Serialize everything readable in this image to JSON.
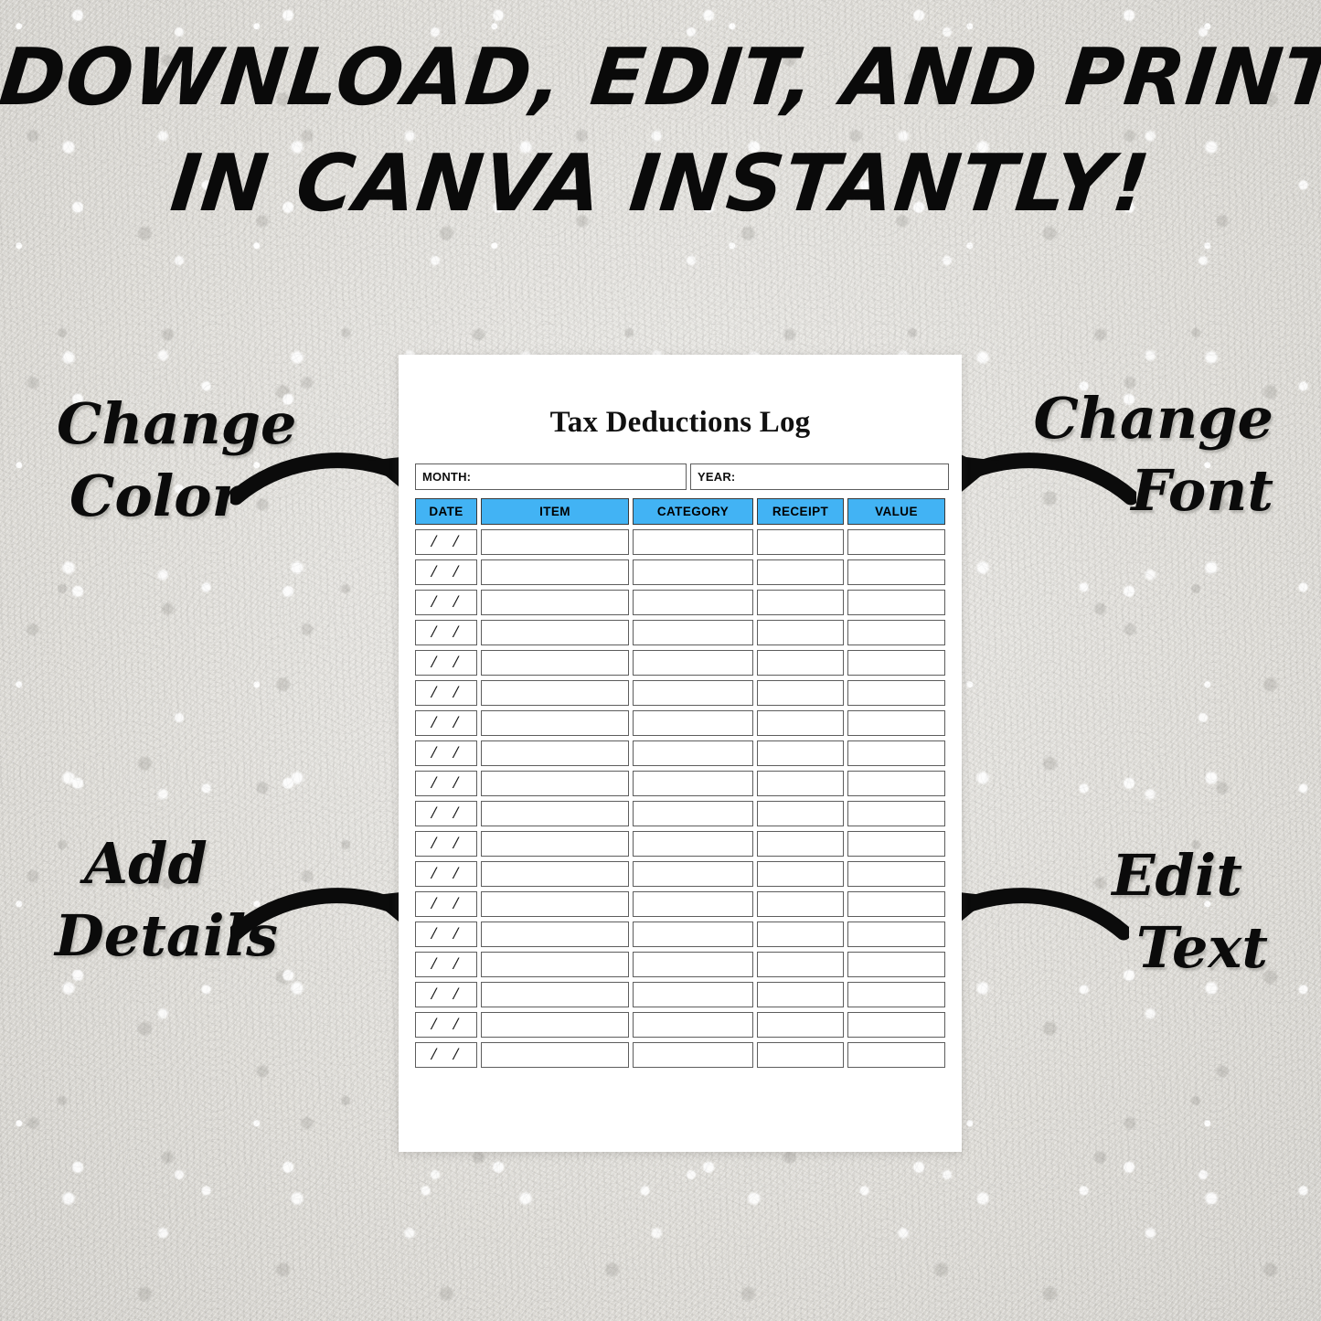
{
  "headline": {
    "line1": "DOWNLOAD, EDIT, AND PRINT",
    "line2": "IN CANVA INSTANTLY!"
  },
  "annotations": [
    {
      "id": "change-color",
      "line1": "Change",
      "line2": "Color",
      "arrow": "curved-arrow-right-icon"
    },
    {
      "id": "change-font",
      "line1": "Change",
      "line2": "Font",
      "arrow": "curved-arrow-left-icon"
    },
    {
      "id": "add-details",
      "line1": "Add",
      "line2": "Details",
      "arrow": "curved-arrow-right-icon"
    },
    {
      "id": "edit-text",
      "line1": "Edit",
      "line2": "Text",
      "arrow": "curved-arrow-left-icon"
    }
  ],
  "printable": {
    "title": "Tax Deductions Log",
    "meta": {
      "month_label": "MONTH:",
      "month_value": "",
      "year_label": "YEAR:",
      "year_value": ""
    },
    "table": {
      "headers": [
        "DATE",
        "ITEM",
        "CATEGORY",
        "RECEIPT",
        "VALUE"
      ],
      "date_placeholder": "/ /",
      "row_count": 18,
      "rows": [
        {
          "date": "/ /",
          "item": "",
          "category": "",
          "receipt": "",
          "value": ""
        },
        {
          "date": "/ /",
          "item": "",
          "category": "",
          "receipt": "",
          "value": ""
        },
        {
          "date": "/ /",
          "item": "",
          "category": "",
          "receipt": "",
          "value": ""
        },
        {
          "date": "/ /",
          "item": "",
          "category": "",
          "receipt": "",
          "value": ""
        },
        {
          "date": "/ /",
          "item": "",
          "category": "",
          "receipt": "",
          "value": ""
        },
        {
          "date": "/ /",
          "item": "",
          "category": "",
          "receipt": "",
          "value": ""
        },
        {
          "date": "/ /",
          "item": "",
          "category": "",
          "receipt": "",
          "value": ""
        },
        {
          "date": "/ /",
          "item": "",
          "category": "",
          "receipt": "",
          "value": ""
        },
        {
          "date": "/ /",
          "item": "",
          "category": "",
          "receipt": "",
          "value": ""
        },
        {
          "date": "/ /",
          "item": "",
          "category": "",
          "receipt": "",
          "value": ""
        },
        {
          "date": "/ /",
          "item": "",
          "category": "",
          "receipt": "",
          "value": ""
        },
        {
          "date": "/ /",
          "item": "",
          "category": "",
          "receipt": "",
          "value": ""
        },
        {
          "date": "/ /",
          "item": "",
          "category": "",
          "receipt": "",
          "value": ""
        },
        {
          "date": "/ /",
          "item": "",
          "category": "",
          "receipt": "",
          "value": ""
        },
        {
          "date": "/ /",
          "item": "",
          "category": "",
          "receipt": "",
          "value": ""
        },
        {
          "date": "/ /",
          "item": "",
          "category": "",
          "receipt": "",
          "value": ""
        },
        {
          "date": "/ /",
          "item": "",
          "category": "",
          "receipt": "",
          "value": ""
        },
        {
          "date": "/ /",
          "item": "",
          "category": "",
          "receipt": "",
          "value": ""
        }
      ]
    }
  },
  "colors": {
    "header_blue": "#42b3f4",
    "page_white": "#ffffff",
    "ink_black": "#0b0b0b",
    "border_gray": "#5d5d5d",
    "background_stone": "#e6e4e0"
  }
}
